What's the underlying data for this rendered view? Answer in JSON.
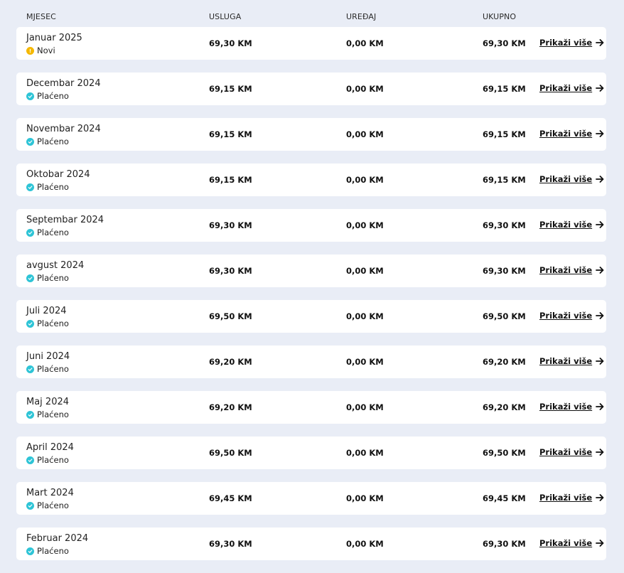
{
  "header": {
    "month": "MJESEC",
    "usluga": "USLUGA",
    "uredjaj": "UREĐAJ",
    "ukupno": "UKUPNO"
  },
  "colors": {
    "paid": "#2ec4d6",
    "new": "#f5b800",
    "background": "#e9edf6",
    "row": "#ffffff"
  },
  "more_label": "Prikaži više",
  "rows": [
    {
      "month": "Januar 2025",
      "status": "Novi",
      "status_type": "new",
      "status_icon": "warning-icon",
      "usluga": "69,30 KM",
      "uredjaj": "0,00 KM",
      "ukupno": "69,30 KM"
    },
    {
      "month": "Decembar 2024",
      "status": "Plaćeno",
      "status_type": "paid",
      "status_icon": "check-icon",
      "usluga": "69,15 KM",
      "uredjaj": "0,00 KM",
      "ukupno": "69,15 KM"
    },
    {
      "month": "Novembar 2024",
      "status": "Plaćeno",
      "status_type": "paid",
      "status_icon": "check-icon",
      "usluga": "69,15 KM",
      "uredjaj": "0,00 KM",
      "ukupno": "69,15 KM"
    },
    {
      "month": "Oktobar 2024",
      "status": "Plaćeno",
      "status_type": "paid",
      "status_icon": "check-icon",
      "usluga": "69,15 KM",
      "uredjaj": "0,00 KM",
      "ukupno": "69,15 KM"
    },
    {
      "month": "Septembar 2024",
      "status": "Plaćeno",
      "status_type": "paid",
      "status_icon": "check-icon",
      "usluga": "69,30 KM",
      "uredjaj": "0,00 KM",
      "ukupno": "69,30 KM"
    },
    {
      "month": "avgust 2024",
      "status": "Plaćeno",
      "status_type": "paid",
      "status_icon": "check-icon",
      "usluga": "69,30 KM",
      "uredjaj": "0,00 KM",
      "ukupno": "69,30 KM"
    },
    {
      "month": "Juli 2024",
      "status": "Plaćeno",
      "status_type": "paid",
      "status_icon": "check-icon",
      "usluga": "69,50 KM",
      "uredjaj": "0,00 KM",
      "ukupno": "69,50 KM"
    },
    {
      "month": "Juni 2024",
      "status": "Plaćeno",
      "status_type": "paid",
      "status_icon": "check-icon",
      "usluga": "69,20 KM",
      "uredjaj": "0,00 KM",
      "ukupno": "69,20 KM"
    },
    {
      "month": "Maj 2024",
      "status": "Plaćeno",
      "status_type": "paid",
      "status_icon": "check-icon",
      "usluga": "69,20 KM",
      "uredjaj": "0,00 KM",
      "ukupno": "69,20 KM"
    },
    {
      "month": "April 2024",
      "status": "Plaćeno",
      "status_type": "paid",
      "status_icon": "check-icon",
      "usluga": "69,50 KM",
      "uredjaj": "0,00 KM",
      "ukupno": "69,50 KM"
    },
    {
      "month": "Mart 2024",
      "status": "Plaćeno",
      "status_type": "paid",
      "status_icon": "check-icon",
      "usluga": "69,45 KM",
      "uredjaj": "0,00 KM",
      "ukupno": "69,45 KM"
    },
    {
      "month": "Februar 2024",
      "status": "Plaćeno",
      "status_type": "paid",
      "status_icon": "check-icon",
      "usluga": "69,30 KM",
      "uredjaj": "0,00 KM",
      "ukupno": "69,30 KM"
    }
  ]
}
